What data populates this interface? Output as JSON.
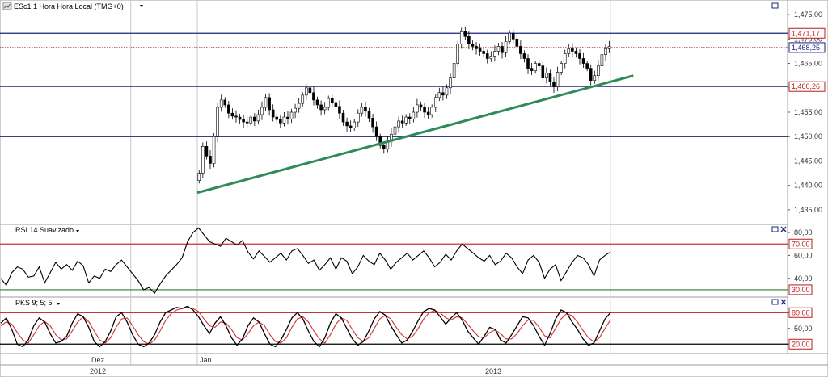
{
  "header": {
    "main_title": "ESc1 1 Hora Hora Local (TMG+0)",
    "rsi_title": "RSI 14 Suavizado",
    "pks_title": "PKS 9; 5; 5"
  },
  "icons": {
    "chart_icon": "chart-icon",
    "dropdown": "chevron-down-icon",
    "maximize": "maximize-icon",
    "close": "close-icon"
  },
  "colors": {
    "candle_up": "#ffffff",
    "candle_down": "#000000",
    "hline": "#1a237e",
    "trend": "#2e8b57",
    "dotted": "#b71c1c",
    "rsi_line": "#000000",
    "rsi_upper": "#d32f2f",
    "rsi_lower": "#2e7d32",
    "pks_k": "#000000",
    "pks_d": "#d32f2f",
    "tag_red": "#b71c1c",
    "tag_blue": "#1a237e"
  },
  "chart_data": [
    {
      "type": "candlestick",
      "title": "ESc1 1 Hora Hora Local (TMG+0)",
      "ylim": [
        1.4325,
        1.4775
      ],
      "y_ticks": [
        "1,475,00",
        "1,470,00",
        "1,465,00",
        "1,460,00",
        "1,455,00",
        "1,450,00",
        "1,445,00",
        "1,440,00",
        "1,435,00"
      ],
      "y_tick_values": [
        1.475,
        1.47,
        1.465,
        1.46,
        1.455,
        1.45,
        1.445,
        1.44,
        1.435
      ],
      "horizontal_lines": [
        1.47117,
        1.46026,
        1.45
      ],
      "dotted_line": 1.46825,
      "price_tags": [
        {
          "text": "1,471,17",
          "value": 1.47117,
          "color": "red"
        },
        {
          "text": "1,468,25",
          "value": 1.46825,
          "color": "blue"
        },
        {
          "text": "1,460,26",
          "value": 1.46026,
          "color": "red"
        }
      ],
      "trendline": {
        "start": [
          0,
          1.4385
        ],
        "end": [
          118,
          1.4625
        ]
      },
      "bar_count": 112,
      "closes": [
        1.4425,
        1.448,
        1.446,
        1.4445,
        1.45,
        1.456,
        1.4575,
        1.4565,
        1.4548,
        1.4542,
        1.454,
        1.4535,
        1.453,
        1.4528,
        1.454,
        1.4532,
        1.4545,
        1.456,
        1.458,
        1.4555,
        1.454,
        1.4535,
        1.4528,
        1.454,
        1.4536,
        1.455,
        1.4558,
        1.4568,
        1.4585,
        1.46,
        1.459,
        1.4575,
        1.4565,
        1.4555,
        1.456,
        1.4578,
        1.457,
        1.4562,
        1.4548,
        1.453,
        1.4522,
        1.4518,
        1.453,
        1.4548,
        1.456,
        1.4552,
        1.4538,
        1.452,
        1.45,
        1.4482,
        1.4475,
        1.449,
        1.4505,
        1.452,
        1.4532,
        1.4528,
        1.454,
        1.4536,
        1.455,
        1.4565,
        1.456,
        1.455,
        1.4545,
        1.456,
        1.458,
        1.459,
        1.4585,
        1.46,
        1.462,
        1.465,
        1.469,
        1.4715,
        1.4705,
        1.469,
        1.4685,
        1.468,
        1.4675,
        1.467,
        1.466,
        1.4665,
        1.4675,
        1.4685,
        1.4672,
        1.4695,
        1.4712,
        1.47,
        1.4685,
        1.467,
        1.466,
        1.464,
        1.4635,
        1.465,
        1.4645,
        1.462,
        1.463,
        1.4612,
        1.4602,
        1.4632,
        1.465,
        1.467,
        1.468,
        1.4675,
        1.467,
        1.466,
        1.465,
        1.464,
        1.4615,
        1.4625,
        1.4645,
        1.4668,
        1.468,
        1.4685
      ]
    },
    {
      "type": "line",
      "title": "RSI 14 Suavizado",
      "ylim": [
        25,
        85
      ],
      "y_ticks": [
        "80,00",
        "60,00",
        "40,00"
      ],
      "y_tick_values": [
        80,
        60,
        40
      ],
      "upper_level": 70,
      "lower_level": 30,
      "level_tags": [
        {
          "text": "70,00",
          "value": 70
        },
        {
          "text": "30,00",
          "value": 30
        }
      ],
      "values": [
        40,
        34,
        45,
        50,
        48,
        41,
        42,
        50,
        36,
        45,
        54,
        48,
        52,
        47,
        55,
        51,
        36,
        42,
        40,
        48,
        46,
        52,
        56,
        50,
        44,
        38,
        30,
        32,
        27,
        35,
        42,
        47,
        52,
        58,
        72,
        80,
        84,
        78,
        72,
        70,
        68,
        75,
        72,
        69,
        73,
        63,
        57,
        64,
        59,
        54,
        58,
        62,
        56,
        64,
        66,
        60,
        53,
        56,
        47,
        52,
        58,
        48,
        58,
        55,
        44,
        50,
        60,
        55,
        52,
        62,
        56,
        48,
        54,
        58,
        62,
        56,
        60,
        64,
        58,
        50,
        54,
        61,
        56,
        64,
        70,
        66,
        62,
        58,
        55,
        60,
        52,
        55,
        62,
        58,
        50,
        44,
        56,
        60,
        54,
        40,
        48,
        52,
        38,
        46,
        54,
        60,
        58,
        52,
        42,
        56,
        60,
        63
      ]
    },
    {
      "type": "line",
      "title": "PKS 9; 5; 5",
      "ylim": [
        5,
        105
      ],
      "y_ticks": [
        "80,00",
        "50,00",
        "20,00"
      ],
      "y_tick_values": [
        80,
        50,
        20
      ],
      "upper_level": 80,
      "lower_level": 20,
      "level_tags": [
        {
          "text": "80,00",
          "value": 80
        },
        {
          "text": "20,00",
          "value": 20
        }
      ],
      "series": [
        {
          "values": [
            60,
            70,
            48,
            20,
            15,
            28,
            55,
            70,
            62,
            40,
            22,
            25,
            35,
            60,
            78,
            72,
            52,
            25,
            15,
            25,
            45,
            72,
            80,
            62,
            38,
            20,
            15,
            22,
            38,
            62,
            80,
            85,
            90,
            88,
            92,
            85,
            72,
            55,
            40,
            60,
            72,
            55,
            32,
            18,
            30,
            55,
            70,
            62,
            40,
            20,
            15,
            28,
            48,
            70,
            80,
            68,
            45,
            25,
            15,
            32,
            60,
            78,
            70,
            50,
            30,
            18,
            25,
            45,
            68,
            82,
            75,
            55,
            38,
            22,
            28,
            45,
            65,
            82,
            88,
            85,
            72,
            58,
            70,
            80,
            66,
            45,
            32,
            20,
            35,
            52,
            48,
            28,
            22,
            38,
            55,
            72,
            70,
            55,
            35,
            18,
            40,
            68,
            85,
            80,
            62,
            48,
            30,
            18,
            22,
            45,
            68,
            80
          ]
        },
        {
          "values": [
            55,
            62,
            58,
            42,
            28,
            22,
            38,
            55,
            63,
            55,
            38,
            28,
            30,
            45,
            62,
            72,
            63,
            45,
            28,
            22,
            32,
            52,
            68,
            70,
            55,
            38,
            25,
            20,
            28,
            45,
            65,
            78,
            85,
            88,
            90,
            88,
            82,
            68,
            55,
            52,
            62,
            60,
            48,
            32,
            28,
            40,
            55,
            62,
            55,
            38,
            25,
            22,
            32,
            52,
            68,
            72,
            62,
            45,
            30,
            22,
            38,
            58,
            70,
            65,
            48,
            32,
            25,
            32,
            50,
            68,
            75,
            68,
            52,
            38,
            30,
            35,
            50,
            68,
            80,
            84,
            80,
            70,
            66,
            72,
            70,
            58,
            45,
            34,
            32,
            42,
            47,
            40,
            30,
            30,
            40,
            55,
            66,
            65,
            52,
            36,
            32,
            50,
            68,
            78,
            74,
            62,
            46,
            32,
            24,
            32,
            50,
            66
          ]
        }
      ]
    }
  ],
  "x_axis": {
    "months": [
      {
        "label": "Dez",
        "bar": -18
      },
      {
        "label": "Jan",
        "bar": 0
      }
    ],
    "years": [
      {
        "label": "2012",
        "bar": -18
      },
      {
        "label": "2013",
        "bar": 56
      }
    ]
  }
}
